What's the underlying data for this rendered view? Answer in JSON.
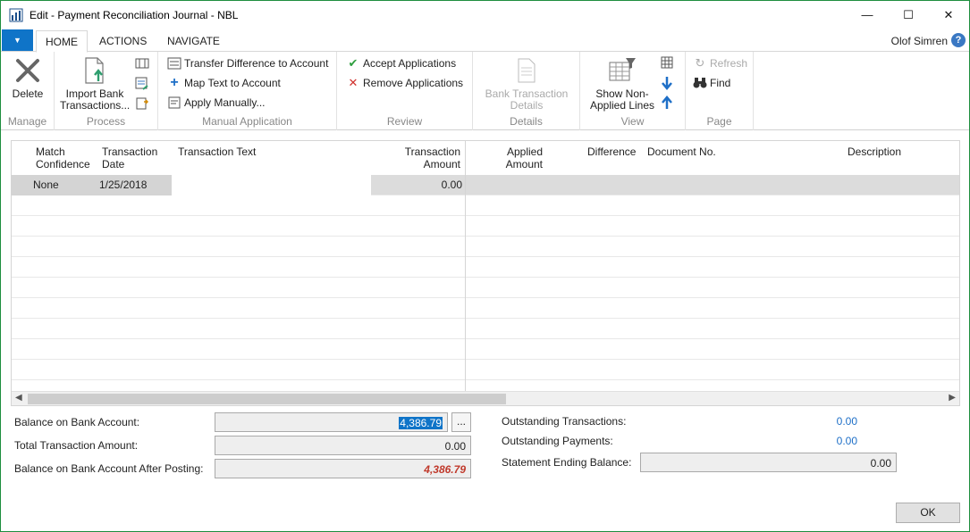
{
  "window": {
    "title": "Edit - Payment Reconciliation Journal - NBL",
    "minimize": "—",
    "maximize": "☐",
    "close": "✕"
  },
  "nav": {
    "app_menu": "▼",
    "tabs": [
      {
        "label": "HOME",
        "active": true
      },
      {
        "label": "ACTIONS",
        "active": false
      },
      {
        "label": "NAVIGATE",
        "active": false
      }
    ],
    "user": "Olof Simren",
    "help": "?"
  },
  "ribbon": {
    "manage": {
      "label": "Manage",
      "delete": "Delete"
    },
    "process": {
      "label": "Process",
      "import": "Import Bank Transactions..."
    },
    "manual": {
      "label": "Manual Application",
      "transfer": "Transfer Difference to Account",
      "map_text": "Map Text to Account",
      "apply_manually": "Apply Manually..."
    },
    "review": {
      "label": "Review",
      "accept": "Accept Applications",
      "remove": "Remove Applications"
    },
    "details": {
      "label": "Details",
      "bank_details": "Bank Transaction Details"
    },
    "view": {
      "label": "View",
      "show_non_applied": "Show Non-Applied Lines"
    },
    "page": {
      "label": "Page",
      "refresh": "Refresh",
      "find": "Find"
    }
  },
  "grid": {
    "columns": {
      "match_confidence": "Match Confidence",
      "transaction_date": "Transaction Date",
      "transaction_text": "Transaction Text",
      "transaction_amount": "Transaction Amount",
      "applied_amount": "Applied Amount",
      "difference": "Difference",
      "document_no": "Document No.",
      "description": "Description"
    },
    "rows": [
      {
        "match_confidence": "None",
        "transaction_date": "1/25/2018",
        "transaction_text": "",
        "transaction_amount": "0.00"
      }
    ]
  },
  "footer": {
    "balance_on_bank_account_label": "Balance on Bank Account:",
    "balance_on_bank_account": "4,386.79",
    "assist_button": "...",
    "total_transaction_amount_label": "Total Transaction Amount:",
    "total_transaction_amount": "0.00",
    "balance_after_posting_label": "Balance on Bank Account After Posting:",
    "balance_after_posting": "4,386.79",
    "outstanding_transactions_label": "Outstanding Transactions:",
    "outstanding_transactions": "0.00",
    "outstanding_payments_label": "Outstanding Payments:",
    "outstanding_payments": "0.00",
    "statement_ending_balance_label": "Statement Ending Balance:",
    "statement_ending_balance": "0.00",
    "ok": "OK"
  },
  "colors": {
    "accent": "#0f74c8",
    "window_border": "#1e8e3e",
    "negative_red": "#c0392b",
    "link_blue": "#1e6fc7"
  }
}
